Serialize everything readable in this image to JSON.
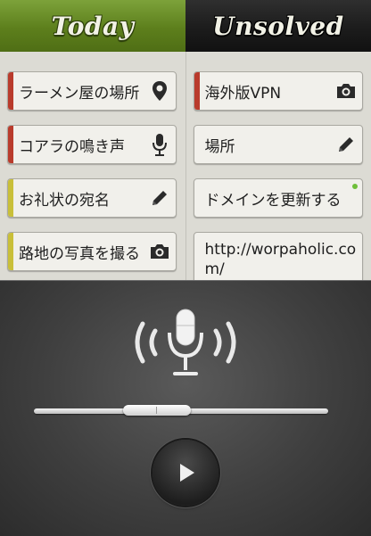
{
  "tabs": {
    "today": "Today",
    "unsolved": "Unsolved"
  },
  "colors": {
    "red_tag": "#b93b2c",
    "yellow_tag": "#c9bf39",
    "new_dot": "#6fbf3a"
  },
  "today_items": [
    {
      "label": "ラーメン屋の場所",
      "icon": "location-pin-icon",
      "tag": "red"
    },
    {
      "label": "コアラの鳴き声",
      "icon": "microphone-icon",
      "tag": "red"
    },
    {
      "label": "お礼状の宛名",
      "icon": "pencil-icon",
      "tag": "yellow"
    },
    {
      "label": "路地の写真を撮る",
      "icon": "camera-icon",
      "tag": "yellow"
    }
  ],
  "unsolved_items": [
    {
      "label": "海外版VPN",
      "icon": "camera-icon",
      "tag": "red"
    },
    {
      "label": "場所",
      "icon": "pencil-icon",
      "tag": "none"
    },
    {
      "label": "ドメインを更新する",
      "icon": "new-dot",
      "tag": "none"
    },
    {
      "label": "http://worpaholic.com/",
      "icon": "none",
      "tag": "none"
    }
  ],
  "player": {
    "position": 0.32
  }
}
